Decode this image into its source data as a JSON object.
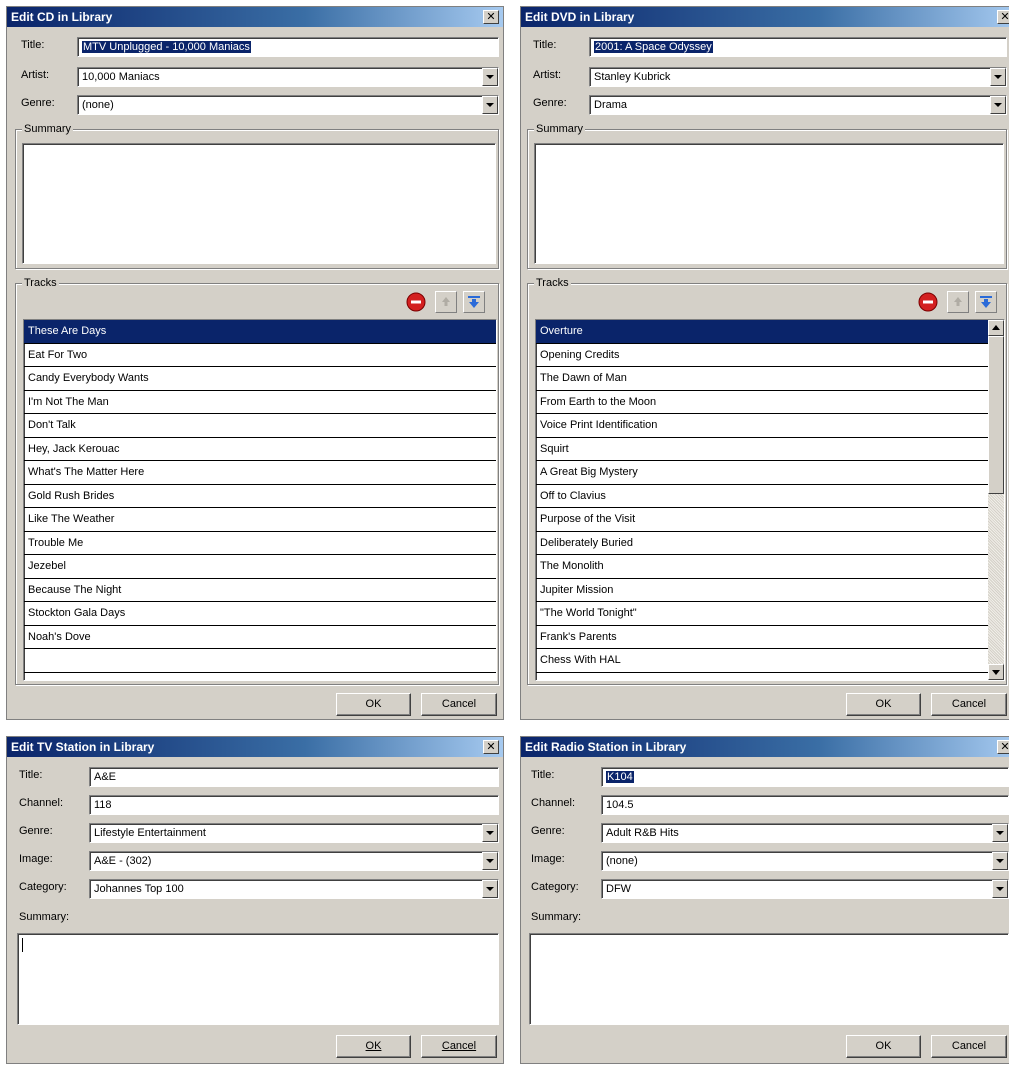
{
  "cd_dialog": {
    "title": "Edit CD in Library",
    "title_label": "Title:",
    "title_value": "MTV Unplugged - 10,000 Maniacs",
    "artist_label": "Artist:",
    "artist_value": "10,000 Maniacs",
    "genre_label": "Genre:",
    "genre_value": "(none)",
    "summary_label": "Summary",
    "tracks_label": "Tracks",
    "tracks": [
      "These Are Days",
      "Eat For Two",
      "Candy Everybody Wants",
      "I'm Not The Man",
      "Don't Talk",
      "Hey, Jack Kerouac",
      "What's The Matter Here",
      "Gold Rush Brides",
      "Like The Weather",
      "Trouble Me",
      "Jezebel",
      "Because The Night",
      "Stockton Gala Days",
      "Noah's Dove",
      ""
    ],
    "ok_label": "OK",
    "cancel_label": "Cancel"
  },
  "dvd_dialog": {
    "title": "Edit DVD in Library",
    "title_label": "Title:",
    "title_value": "2001: A Space Odyssey",
    "artist_label": "Artist:",
    "artist_value": "Stanley Kubrick",
    "genre_label": "Genre:",
    "genre_value": "Drama",
    "summary_label": "Summary",
    "tracks_label": "Tracks",
    "tracks": [
      "Overture",
      "Opening Credits",
      "The Dawn of Man",
      "From Earth to the Moon",
      "Voice Print Identification",
      "Squirt",
      "A Great Big Mystery",
      "Off to Clavius",
      "Purpose of the Visit",
      "Deliberately Buried",
      "The Monolith",
      "Jupiter Mission",
      "\"The World Tonight\"",
      "Frank's Parents",
      "Chess With HAL"
    ],
    "ok_label": "OK",
    "cancel_label": "Cancel"
  },
  "tv_dialog": {
    "title": "Edit TV Station in Library",
    "title_label": "Title:",
    "title_value": "A&E",
    "channel_label": "Channel:",
    "channel_value": "118",
    "genre_label": "Genre:",
    "genre_value": "Lifestyle Entertainment",
    "image_label": "Image:",
    "image_value": "A&E - (302)",
    "category_label": "Category:",
    "category_value": "Johannes Top 100",
    "summary_label": "Summary:",
    "ok_label": "OK",
    "cancel_label": "Cancel"
  },
  "radio_dialog": {
    "title": "Edit Radio Station in Library",
    "title_label": "Title:",
    "title_value": "K104",
    "channel_label": "Channel:",
    "channel_value": "104.5",
    "genre_label": "Genre:",
    "genre_value": "Adult R&B Hits",
    "image_label": "Image:",
    "image_value": "(none)",
    "category_label": "Category:",
    "category_value": "DFW",
    "summary_label": "Summary:",
    "ok_label": "OK",
    "cancel_label": "Cancel"
  },
  "icons": {
    "close": "close-icon",
    "remove": "remove-icon",
    "move_up": "arrow-up-icon",
    "move_down": "arrow-down-icon",
    "dropdown": "chevron-down-icon"
  },
  "colors": {
    "titlebar_start": "#0a246a",
    "titlebar_end": "#a6caf0",
    "dialog_face": "#d4d0c8",
    "selection": "#0a246a"
  }
}
